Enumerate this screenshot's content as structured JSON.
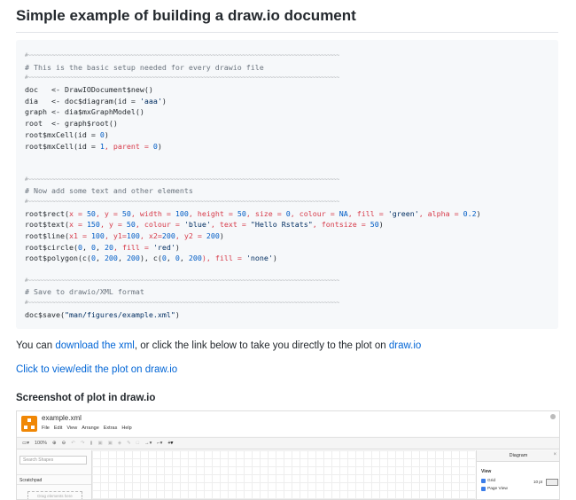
{
  "heading": "Simple example of building a draw.io document",
  "code": {
    "tilde": "#~~~~~~~~~~~~~~~~~~~~~~~~~~~~~~~~~~~~~~~~~~~~~~~~~~~~~~~~~~~~~~~~~~~~~~~~~~~~~~~~~~~~~~~~~~~~~~~~~~~~~~~",
    "comment1": "# This is the basic setup needed for every drawio file",
    "l_doc": "doc   <- DrawIODocument$new()",
    "l_dia_a": "dia   <- doc$diagram(id = ",
    "l_dia_s": "'aaa'",
    "l_dia_b": ")",
    "l_graph": "graph <- dia$mxGraphModel()",
    "l_root": "root  <- graph$root()",
    "l_cell0_a": "root$mxCell(id = ",
    "l_cell0_n": "0",
    "l_cell0_b": ")",
    "l_cell1_a": "root$mxCell(id = ",
    "l_cell1_n": "1",
    "l_cell1_m": ", parent = ",
    "l_cell1_p": "0",
    "l_cell1_b": ")",
    "comment2": "# Now add some text and other elements",
    "l_rect_a": "root$rect(",
    "l_rect_k1": "x = ",
    "l_rect_v1": "50",
    "l_rect_k2": ", y = ",
    "l_rect_v2": "50",
    "l_rect_k3": ", width = ",
    "l_rect_v3": "100",
    "l_rect_k4": ", height = ",
    "l_rect_v4": "50",
    "l_rect_k5": ", size = ",
    "l_rect_v5": "0",
    "l_rect_k6": ", colour = ",
    "l_rect_v6": "NA",
    "l_rect_k7": ", fill = ",
    "l_rect_v7": "'green'",
    "l_rect_k8": ", alpha = ",
    "l_rect_v8": "0.2",
    "l_rect_b": ")",
    "l_text_a": "root$text(",
    "l_text_k1": "x = ",
    "l_text_v1": "150",
    "l_text_k2": ", y = ",
    "l_text_v2": "50",
    "l_text_k3": ", colour = ",
    "l_text_v3": "'blue'",
    "l_text_k4": ", text = ",
    "l_text_v4": "\"Hello Rstats\"",
    "l_text_k5": ", fontsize = ",
    "l_text_v5": "50",
    "l_text_b": ")",
    "l_line_a": "root$line(",
    "l_line_k1": "x1 = ",
    "l_line_v1": "100",
    "l_line_k2": ", y1=",
    "l_line_v2": "100",
    "l_line_k3": ", x2=",
    "l_line_v3": "200",
    "l_line_k4": ", y2 = ",
    "l_line_v4": "200",
    "l_line_b": ")",
    "l_circ_a": "root$circle(",
    "l_circ_v1": "0",
    "l_circ_s1": ", ",
    "l_circ_v2": "0",
    "l_circ_s2": ", ",
    "l_circ_v3": "20",
    "l_circ_k4": ", fill = ",
    "l_circ_v4": "'red'",
    "l_circ_b": ")",
    "l_poly_a": "root$polygon(c(",
    "l_poly_v1": "0",
    "l_poly_s1": ", ",
    "l_poly_v2": "200",
    "l_poly_s2": ", ",
    "l_poly_v3": "200",
    "l_poly_m": "), c(",
    "l_poly_v4": "0",
    "l_poly_s3": ", ",
    "l_poly_v5": "0",
    "l_poly_s4": ", ",
    "l_poly_v6": "200",
    "l_poly_k": "), fill = ",
    "l_poly_v7": "'none'",
    "l_poly_b": ")",
    "comment3": "# Save to drawio/XML format",
    "l_save_a": "doc$save(",
    "l_save_s": "\"man/figures/example.xml\"",
    "l_save_b": ")"
  },
  "para1": {
    "pre": "You can ",
    "link": "download the xml",
    "mid": ", or click the link below to take you directly to the plot on ",
    "link2": "draw.io"
  },
  "para2_link": "Click to view/edit the plot on draw.io",
  "subheading": "Screenshot of plot in draw.io",
  "screenshot": {
    "filename": "example.xml",
    "menu": [
      "File",
      "Edit",
      "View",
      "Arrange",
      "Extras",
      "Help"
    ],
    "zoom": "100%",
    "search_placeholder": "Search Shapes",
    "scratchpad": "Scratchpad",
    "drag_hint": "Drag elements here",
    "panel_title": "Diagram",
    "view_label": "View",
    "grid_label": "Grid",
    "page_view_label": "Page View",
    "grid_size": "10 pt"
  }
}
